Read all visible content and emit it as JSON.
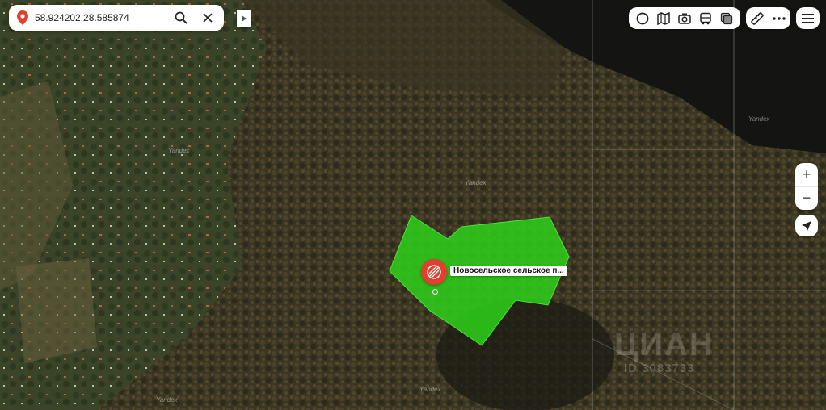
{
  "search": {
    "query": "58.924202,28.585874"
  },
  "toolbar": {
    "layers": [
      "panorama-icon",
      "map-layers-icon",
      "camera-icon",
      "bus-icon",
      "copy-icon"
    ],
    "tools": [
      "ruler-icon",
      "more-icon"
    ]
  },
  "zoom": {
    "in_label": "+",
    "out_label": "−"
  },
  "marker": {
    "label": "Новосельское сельское п..."
  },
  "watermarks": {
    "yandex": "Yandex",
    "brand": "ЦИАН",
    "brand_sub": "ID 3083733"
  },
  "colors": {
    "parcel_fill": "#2ecc1a",
    "marker": "#e0402e",
    "water": "#141512"
  }
}
